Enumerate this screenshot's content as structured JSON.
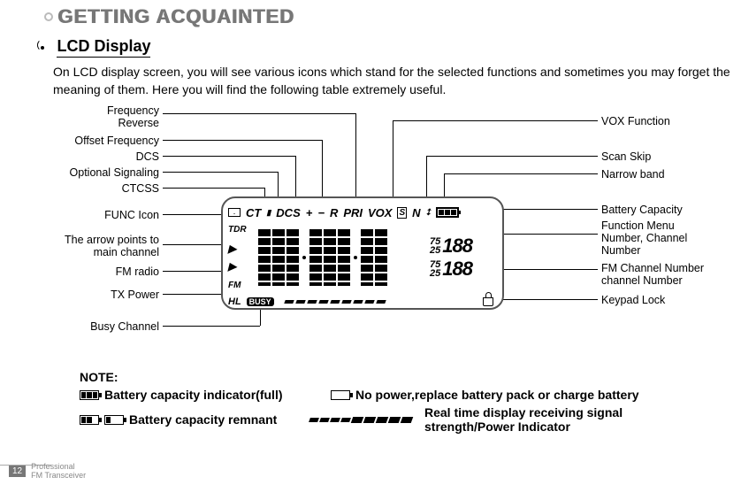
{
  "header": {
    "title": "GETTING ACQUAINTED"
  },
  "section": {
    "title": "LCD Display"
  },
  "intro": "On LCD display screen, you will see various icons which stand for the selected functions and sometimes you may forget the meaning of them. Here you will find the following table extremely useful.",
  "lcd": {
    "top_indicators": {
      "ct": "CT",
      "dcs": "DCS",
      "plus": "+",
      "minus": "−",
      "r": "R",
      "pri": "PRI",
      "vox": "VOX",
      "s": "S",
      "n": "N"
    },
    "left": {
      "tdr": "TDR",
      "fm": "FM",
      "hl": "HL"
    },
    "busy": "BUSY",
    "right_pairs": [
      {
        "small_top": "75",
        "small_bot": "25",
        "big": "188"
      },
      {
        "small_top": "75",
        "small_bot": "25",
        "big": "188"
      }
    ]
  },
  "labels_left": [
    "Frequency\nReverse",
    "Offset Frequency",
    "DCS",
    "Optional Signaling",
    "CTCSS",
    "FUNC Icon",
    "The arrow points to\nmain channel",
    "FM radio",
    "TX Power",
    "Busy Channel"
  ],
  "labels_right": [
    "VOX Function",
    "Scan Skip",
    "Narrow band",
    "Battery Capacity",
    "Function Menu\nNumber, Channel\nNumber",
    "FM Channel Number\nchannel Number",
    "Keypad Lock"
  ],
  "note": {
    "title": "NOTE:",
    "row1_a": "Battery capacity indicator(full)",
    "row1_b": "No power,replace battery pack or charge battery",
    "row2_a": "Battery capacity remnant",
    "row2_b": "Real time display receiving signal\nstrength/Power Indicator"
  },
  "footer": {
    "page": "12",
    "line1": "Professional",
    "line2": "FM Transceiver"
  }
}
